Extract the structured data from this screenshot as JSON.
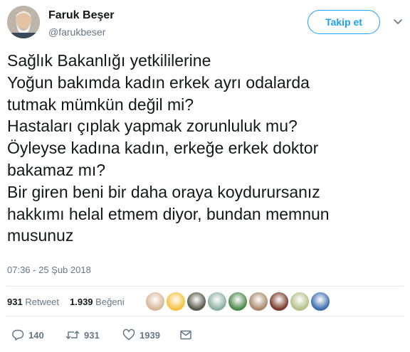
{
  "user": {
    "name": "Faruk Beşer",
    "handle": "@farukbeser",
    "follow_label": "Takip et"
  },
  "tweet": {
    "lines": [
      "Sağlık Bakanlığı yetkililerine",
      "Yoğun bakımda kadın erkek ayrı odalarda",
      "tutmak mümkün değil mi?",
      "Hastaları çıplak yapmak zorunluluk mu?",
      "Öyleyse kadına kadın, erkeğe erkek doktor",
      "bakamaz mı?",
      "Bir giren beni bir daha oraya koydurursanız",
      "hakkımı helal etmem diyor, bundan memnun",
      "musunuz"
    ],
    "timestamp": "07:36 - 25 Şub 2018"
  },
  "stats": {
    "retweet_count": "931",
    "retweet_label": "Retweet",
    "like_count": "1.939",
    "like_label": "Beğeni"
  },
  "likers": [
    "#d7b89a",
    "#f5c242",
    "#5b5a4e",
    "#8fb0a3",
    "#4d8a4a",
    "#a88a6c",
    "#7b3b2e",
    "#b5c28a",
    "#3f6fb0"
  ],
  "actions": {
    "reply_count": "140",
    "retweet_count": "931",
    "like_count": "1939"
  },
  "colors": {
    "accent": "#1da1f2",
    "muted": "#657786",
    "text": "#14171a"
  }
}
